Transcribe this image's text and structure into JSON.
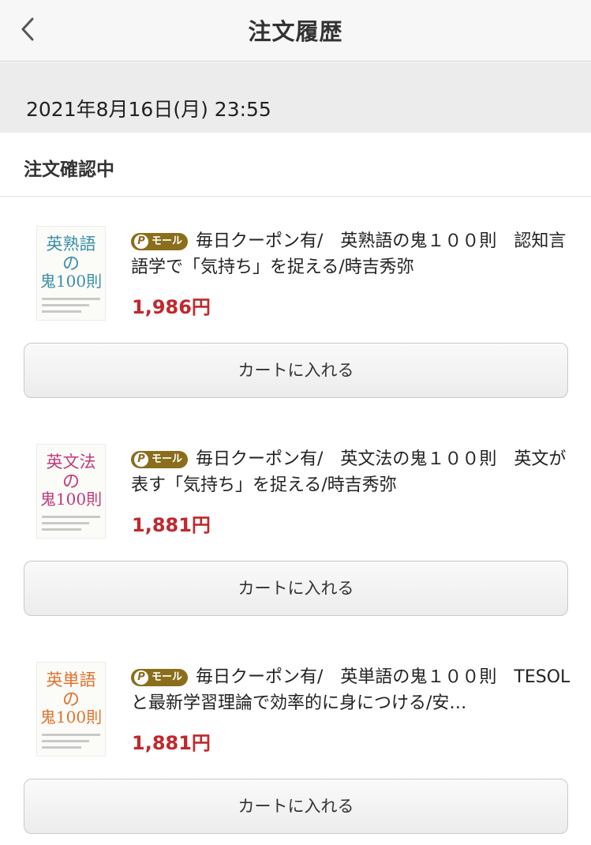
{
  "header": {
    "title": "注文履歴",
    "back_icon": "chevron-left-icon"
  },
  "order": {
    "datetime": "2021年8月16日(月) 23:55",
    "status": "注文確認中"
  },
  "badge": {
    "icon": "P",
    "label": "モール"
  },
  "items": [
    {
      "thumb": {
        "line1": "英熟語",
        "line2": "の",
        "line3": "鬼100則",
        "color": "#3a8fa8"
      },
      "title": "毎日クーポン有/　英熟語の鬼１００則　認知言語学で「気持ち」を捉える/時吉秀弥",
      "price": "1,986円",
      "cart_label": "カートに入れる"
    },
    {
      "thumb": {
        "line1": "英文法",
        "line2": "の",
        "line3": "鬼100則",
        "color": "#c23a7a"
      },
      "title": "毎日クーポン有/　英文法の鬼１００則　英文が表す「気持ち」を捉える/時吉秀弥",
      "price": "1,881円",
      "cart_label": "カートに入れる"
    },
    {
      "thumb": {
        "line1": "英単語",
        "line2": "の",
        "line3": "鬼100則",
        "color": "#e0722e"
      },
      "title": "毎日クーポン有/　英単語の鬼１００則　TESOLと最新学習理論で効率的に身につける/安…",
      "price": "1,881円",
      "cart_label": "カートに入れる"
    }
  ],
  "colors": {
    "price": "#c0282d",
    "badge": "#8a6e1b"
  }
}
